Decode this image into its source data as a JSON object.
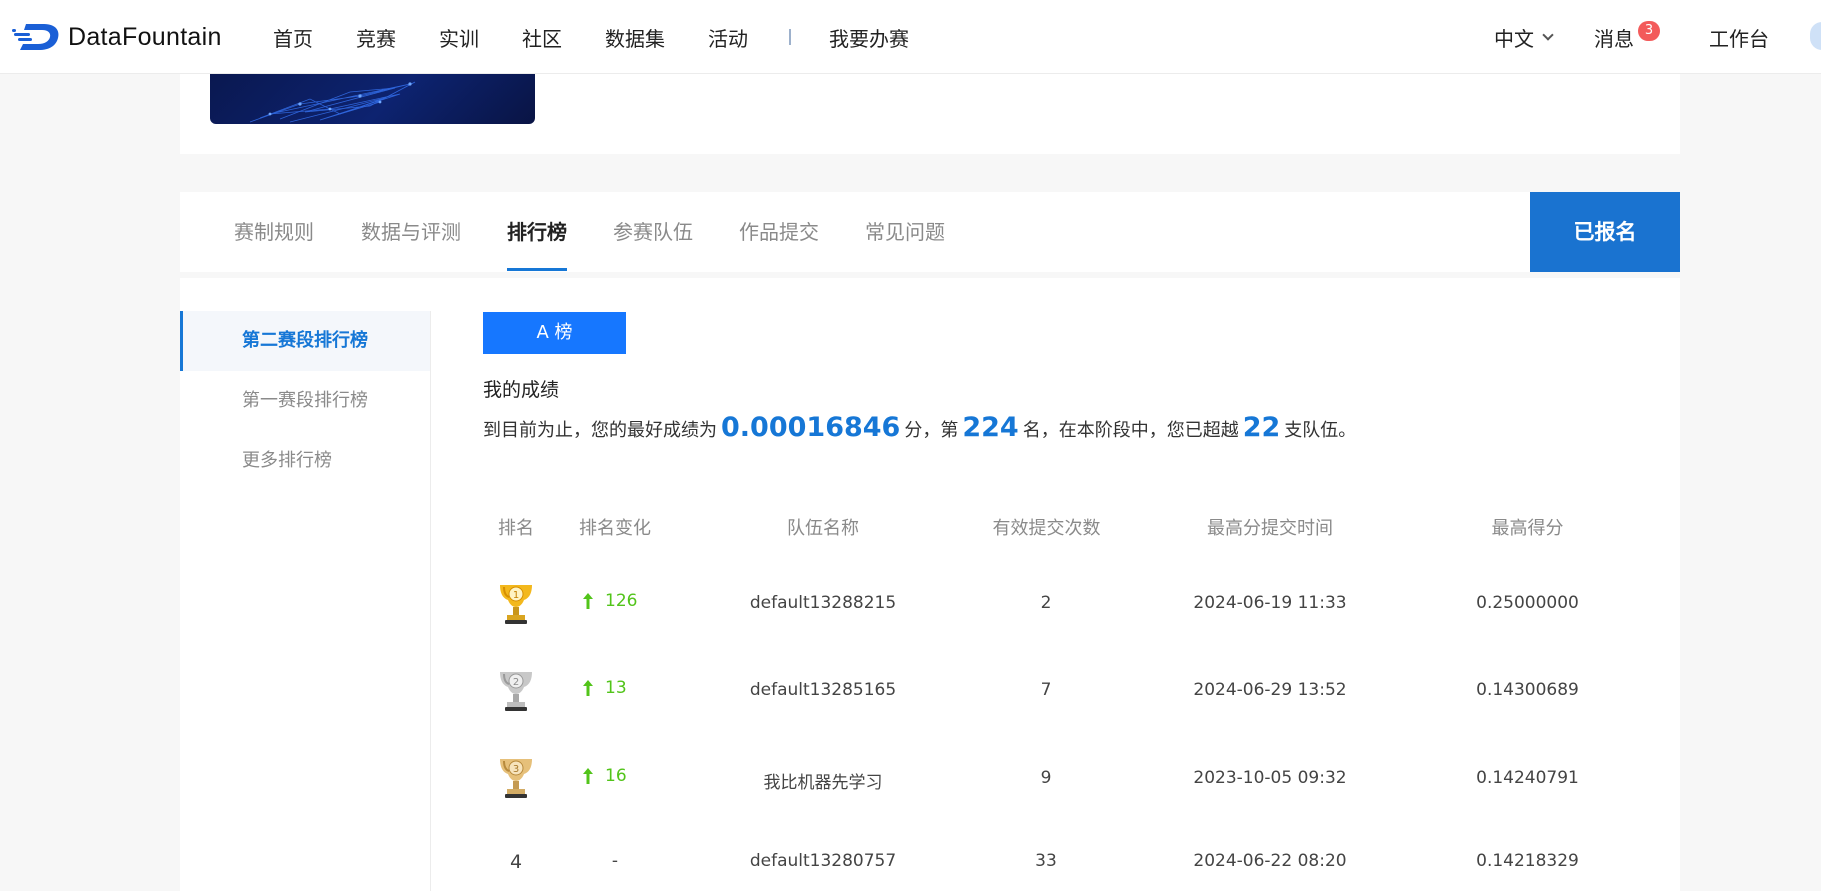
{
  "brand": {
    "name": "DataFountain",
    "accent": "#1677d6"
  },
  "nav": {
    "items": [
      "首页",
      "竞赛",
      "实训",
      "社区",
      "数据集",
      "活动"
    ],
    "host": "我要办赛",
    "language": "中文",
    "messages": "消息",
    "message_count": "3",
    "workbench": "工作台"
  },
  "tabs": [
    {
      "label": "赛制规则",
      "active": false
    },
    {
      "label": "数据与评测",
      "active": false
    },
    {
      "label": "排行榜",
      "active": true
    },
    {
      "label": "参赛队伍",
      "active": false
    },
    {
      "label": "作品提交",
      "active": false
    },
    {
      "label": "常见问题",
      "active": false
    }
  ],
  "signup_button": "已报名",
  "sidebar": {
    "items": [
      {
        "label": "第二赛段排行榜",
        "active": true
      },
      {
        "label": "第一赛段排行榜",
        "active": false
      },
      {
        "label": "更多排行榜",
        "active": false
      }
    ]
  },
  "board": {
    "button": "A 榜",
    "my_score_title": "我的成绩",
    "summary": {
      "prefix": "到目前为止，您的最好成绩为",
      "best_score": "0.00016846",
      "score_unit": "分，第",
      "rank": "224",
      "rank_unit": "名，在本阶段中，您已超越",
      "beaten": "22",
      "suffix": "支队伍。"
    }
  },
  "table": {
    "columns": [
      "排名",
      "排名变化",
      "队伍名称",
      "有效提交次数",
      "最高分提交时间",
      "最高得分"
    ],
    "rows": [
      {
        "rank": "1",
        "trophy": "gold-trophy-icon",
        "change": "126",
        "change_dir": "up",
        "team": "default13288215",
        "submissions": "2",
        "time": "2024-06-19 11:33",
        "score": "0.25000000"
      },
      {
        "rank": "2",
        "trophy": "silver-trophy-icon",
        "change": "13",
        "change_dir": "up",
        "team": "default13285165",
        "submissions": "7",
        "time": "2024-06-29 13:52",
        "score": "0.14300689"
      },
      {
        "rank": "3",
        "trophy": "bronze-trophy-icon",
        "change": "16",
        "change_dir": "up",
        "team": "我比机器先学习",
        "submissions": "9",
        "time": "2023-10-05 09:32",
        "score": "0.14240791"
      },
      {
        "rank": "4",
        "trophy": "",
        "change": "-",
        "change_dir": "none",
        "team": "default13280757",
        "submissions": "33",
        "time": "2024-06-22 08:20",
        "score": "0.14218329"
      }
    ]
  }
}
